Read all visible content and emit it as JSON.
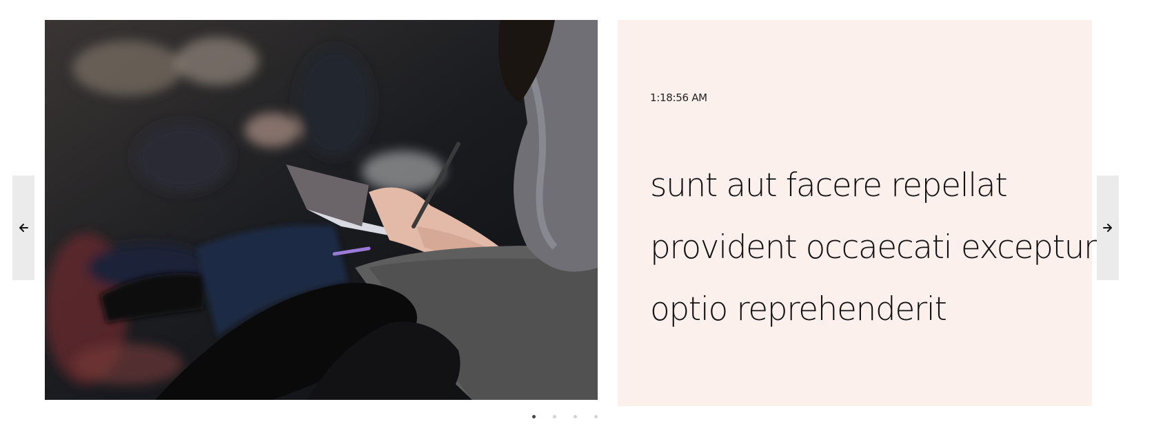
{
  "carousel": {
    "prev_icon": "arrow-left-icon",
    "next_icon": "arrow-right-icon",
    "slide": {
      "image_alt": "Audience seated in a row taking notes",
      "time": "1:18:56 AM",
      "title_lines": [
        "sunt aut facere repellat",
        "provident occaecati excepturi",
        "optio reprehenderit"
      ]
    },
    "dots": {
      "count": 4,
      "active_index": 0
    },
    "colors": {
      "panel_bg": "#fcf0ed",
      "nav_bg": "#ebebeb",
      "dot_active": "#444444",
      "dot_inactive": "#d4d4d4"
    }
  }
}
